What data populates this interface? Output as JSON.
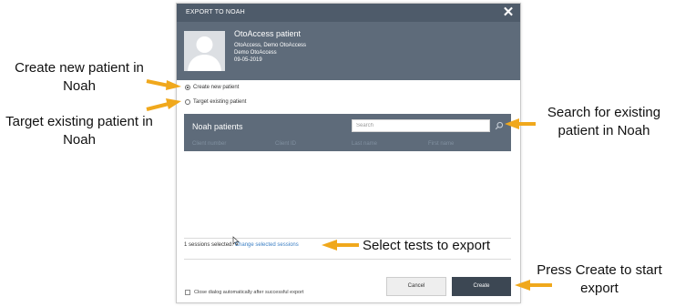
{
  "dialog": {
    "title": "EXPORT TO NOAH",
    "close_glyph": "✕",
    "patient": {
      "name": "OtoAccess patient",
      "line1": "OtoAccess, Demo OtoAccess",
      "line2": "Demo OtoAccess",
      "date": "09-05-2019"
    },
    "options": {
      "create_new": "Create new patient",
      "target_existing": "Target existing patient",
      "selected": "create_new"
    },
    "noah_panel": {
      "title": "Noah patients",
      "search_placeholder": "Search",
      "columns": [
        "Client number",
        "Client ID",
        "Last name",
        "First name"
      ]
    },
    "sessions": {
      "count_text": "1 sessions selected.",
      "change_link": "Change selected sessions"
    },
    "close_auto_label": "Close dialog automatically after successful export",
    "cancel_label": "Cancel",
    "create_label": "Create"
  },
  "annotations": {
    "create_new": "Create new patient in Noah",
    "target_existing": "Target existing patient in Noah",
    "search": "Search for existing patient in Noah",
    "select_tests": "Select tests to export",
    "press_create": "Press Create to start export"
  },
  "colors": {
    "header_dark": "#4e5b6a",
    "header_mid": "#5e6b7a",
    "create_button": "#3c4753",
    "link": "#3b7fc4",
    "arrow": "#f0a81c"
  }
}
